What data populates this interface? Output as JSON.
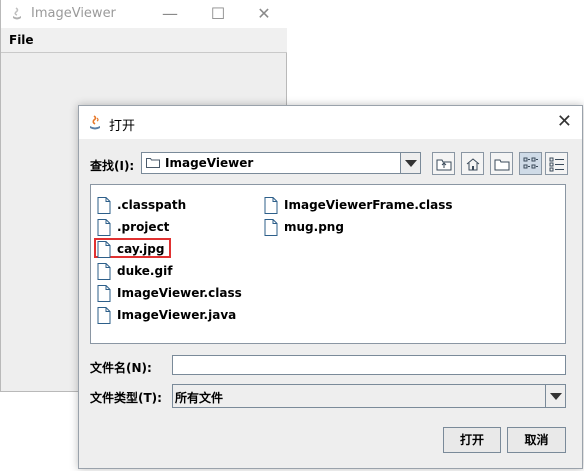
{
  "main_window": {
    "title": "ImageViewer",
    "menu": {
      "file_label": "File"
    }
  },
  "dialog": {
    "title": "打开",
    "look_in": {
      "label": "查找(I):",
      "value": "ImageViewer"
    },
    "toolbar": [
      "up-one-level-icon",
      "home-icon",
      "new-folder-icon",
      "list-view-icon",
      "details-view-icon"
    ],
    "files": [
      {
        "name": ".classpath"
      },
      {
        "name": ".project"
      },
      {
        "name": "cay.jpg"
      },
      {
        "name": "duke.gif"
      },
      {
        "name": "ImageViewer.class"
      },
      {
        "name": "ImageViewer.java"
      },
      {
        "name": "ImageViewerFrame.class"
      },
      {
        "name": "mug.png"
      }
    ],
    "file_name": {
      "label": "文件名(N):",
      "value": ""
    },
    "file_type": {
      "label": "文件类型(T):",
      "value": "所有文件"
    },
    "buttons": {
      "open": "打开",
      "cancel": "取消"
    },
    "highlight_color": "#e03131"
  }
}
